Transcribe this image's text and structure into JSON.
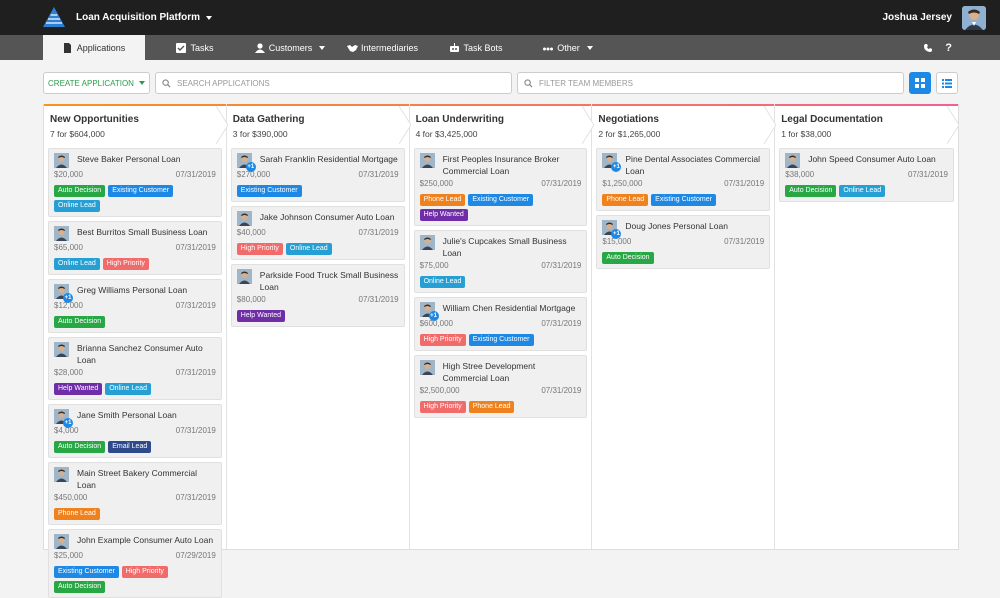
{
  "app": {
    "title": "Loan Acquisition Platform",
    "user_name": "Joshua Jersey"
  },
  "nav": {
    "tabs": [
      {
        "label": "Applications",
        "icon": "document-icon",
        "active": true,
        "caret": false
      },
      {
        "label": "Tasks",
        "icon": "checkbox-icon",
        "active": false,
        "caret": false
      },
      {
        "label": "Customers",
        "icon": "person-icon",
        "active": false,
        "caret": true
      },
      {
        "label": "Intermediaries",
        "icon": "handshake-icon",
        "active": false,
        "caret": false
      },
      {
        "label": "Task Bots",
        "icon": "robot-icon",
        "active": false,
        "caret": false
      },
      {
        "label": "Other",
        "icon": "dots-icon",
        "active": false,
        "caret": true
      }
    ],
    "right": {
      "phone_icon": "phone-icon",
      "help_label": "?"
    }
  },
  "toolbar": {
    "create_label": "CREATE APPLICATION",
    "search_placeholder": "SEARCH APPLICATIONS",
    "filter_placeholder": "FILTER TEAM MEMBERS"
  },
  "colors": {
    "Auto Decision": "#28a745",
    "Existing Customer": "#1e88e5",
    "Online Lead": "#26a0d4",
    "High Priority": "#f26b6b",
    "Help Wanted": "#6f2da8",
    "Email Lead": "#2e4a8a",
    "Phone Lead": "#f0821e"
  },
  "columns": [
    {
      "title": "New Opportunities",
      "summary": "7 for $604,000",
      "cards": [
        {
          "title": "Steve Baker Personal Loan",
          "amount": "$20,000",
          "date": "07/31/2019",
          "plus": "",
          "tags": [
            "Auto Decision",
            "Existing Customer",
            "Online Lead"
          ]
        },
        {
          "title": "Best Burritos Small Business Loan",
          "amount": "$65,000",
          "date": "07/31/2019",
          "plus": "",
          "tags": [
            "Online Lead",
            "High Priority"
          ]
        },
        {
          "title": "Greg Williams Personal Loan",
          "amount": "$12,000",
          "date": "07/31/2019",
          "plus": "+1",
          "tags": [
            "Auto Decision"
          ]
        },
        {
          "title": "Brianna Sanchez Consumer Auto Loan",
          "amount": "$28,000",
          "date": "07/31/2019",
          "plus": "",
          "tags": [
            "Help Wanted",
            "Online Lead"
          ]
        },
        {
          "title": "Jane Smith Personal Loan",
          "amount": "$4,000",
          "date": "07/31/2019",
          "plus": "+1",
          "tags": [
            "Auto Decision",
            "Email Lead"
          ]
        },
        {
          "title": "Main Street Bakery Commercial Loan",
          "amount": "$450,000",
          "date": "07/31/2019",
          "plus": "",
          "tags": [
            "Phone Lead"
          ]
        },
        {
          "title": "John Example Consumer Auto Loan",
          "amount": "$25,000",
          "date": "07/29/2019",
          "plus": "",
          "tags": [
            "Existing Customer",
            "High Priority",
            "Auto Decision"
          ]
        }
      ]
    },
    {
      "title": "Data Gathering",
      "summary": "3 for $390,000",
      "cards": [
        {
          "title": "Sarah Franklin Residential Mortgage",
          "amount": "$270,000",
          "date": "07/31/2019",
          "plus": "+1",
          "tags": [
            "Existing Customer"
          ]
        },
        {
          "title": "Jake Johnson Consumer Auto Loan",
          "amount": "$40,000",
          "date": "07/31/2019",
          "plus": "",
          "tags": [
            "High Priority",
            "Online Lead"
          ]
        },
        {
          "title": "Parkside Food Truck Small Business Loan",
          "amount": "$80,000",
          "date": "07/31/2019",
          "plus": "",
          "tags": [
            "Help Wanted"
          ]
        }
      ]
    },
    {
      "title": "Loan Underwriting",
      "summary": "4 for $3,425,000",
      "cards": [
        {
          "title": "First Peoples Insurance Broker Commercial Loan",
          "amount": "$250,000",
          "date": "07/31/2019",
          "plus": "",
          "tags": [
            "Phone Lead",
            "Existing Customer",
            "Help Wanted"
          ]
        },
        {
          "title": "Julie's Cupcakes Small Business Loan",
          "amount": "$75,000",
          "date": "07/31/2019",
          "plus": "",
          "tags": [
            "Online Lead"
          ]
        },
        {
          "title": "William Chen Residential Mortgage",
          "amount": "$600,000",
          "date": "07/31/2019",
          "plus": "+1",
          "tags": [
            "High Priority",
            "Existing Customer"
          ]
        },
        {
          "title": "High Stree Development Commercial Loan",
          "amount": "$2,500,000",
          "date": "07/31/2019",
          "plus": "",
          "tags": [
            "High Priority",
            "Phone Lead"
          ]
        }
      ]
    },
    {
      "title": "Negotiations",
      "summary": "2 for $1,265,000",
      "cards": [
        {
          "title": "Pine Dental Associates Commercial Loan",
          "amount": "$1,250,000",
          "date": "07/31/2019",
          "plus": "+1",
          "tags": [
            "Phone Lead",
            "Existing Customer"
          ]
        },
        {
          "title": "Doug Jones Personal Loan",
          "amount": "$15,000",
          "date": "07/31/2019",
          "plus": "+1",
          "tags": [
            "Auto Decision"
          ]
        }
      ]
    },
    {
      "title": "Legal Documentation",
      "summary": "1 for $38,000",
      "cards": [
        {
          "title": "John Speed Consumer Auto Loan",
          "amount": "$38,000",
          "date": "07/31/2019",
          "plus": "",
          "tags": [
            "Auto Decision",
            "Online Lead"
          ]
        }
      ]
    }
  ]
}
